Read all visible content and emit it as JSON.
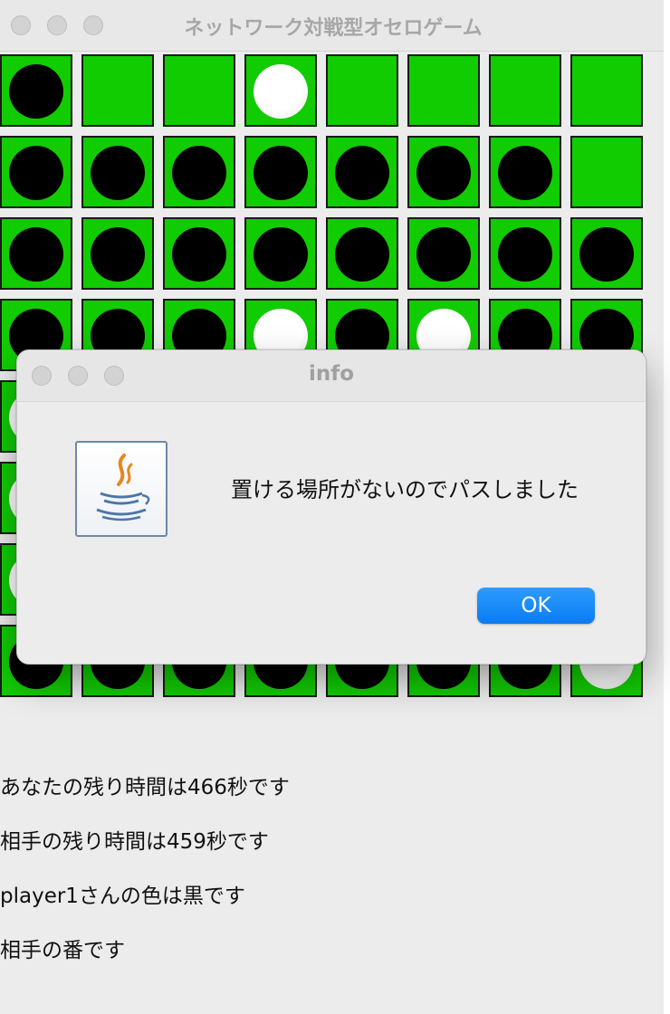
{
  "window": {
    "title": "ネットワーク対戦型オセロゲーム"
  },
  "board": {
    "size": 8,
    "colors": {
      "cell": "#11cc00",
      "black": "#000000",
      "white": "#ffffff"
    },
    "cells": [
      [
        "black",
        "",
        "",
        "white",
        "",
        "",
        "",
        ""
      ],
      [
        "black",
        "black",
        "black",
        "black",
        "black",
        "black",
        "black",
        ""
      ],
      [
        "black",
        "black",
        "black",
        "black",
        "black",
        "black",
        "black",
        "black"
      ],
      [
        "black",
        "black",
        "black",
        "white",
        "black",
        "white",
        "black",
        "black"
      ],
      [
        "white",
        "",
        "",
        "",
        "",
        "",
        "",
        ""
      ],
      [
        "white",
        "",
        "",
        "",
        "",
        "",
        "",
        ""
      ],
      [
        "white",
        "",
        "",
        "",
        "",
        "",
        "",
        ""
      ],
      [
        "black",
        "black",
        "black",
        "black",
        "black",
        "black",
        "black",
        "white"
      ]
    ]
  },
  "status": {
    "my_time": "あなたの残り時間は466秒です",
    "opponent_time": "相手の残り時間は459秒です",
    "player_color": "player1さんの色は黒です",
    "turn": "相手の番です"
  },
  "dialog": {
    "title": "info",
    "icon": "java-coffee-icon",
    "message": "置ける場所がないのでパスしました",
    "ok_label": "OK",
    "accent": "#0a7cf2"
  }
}
